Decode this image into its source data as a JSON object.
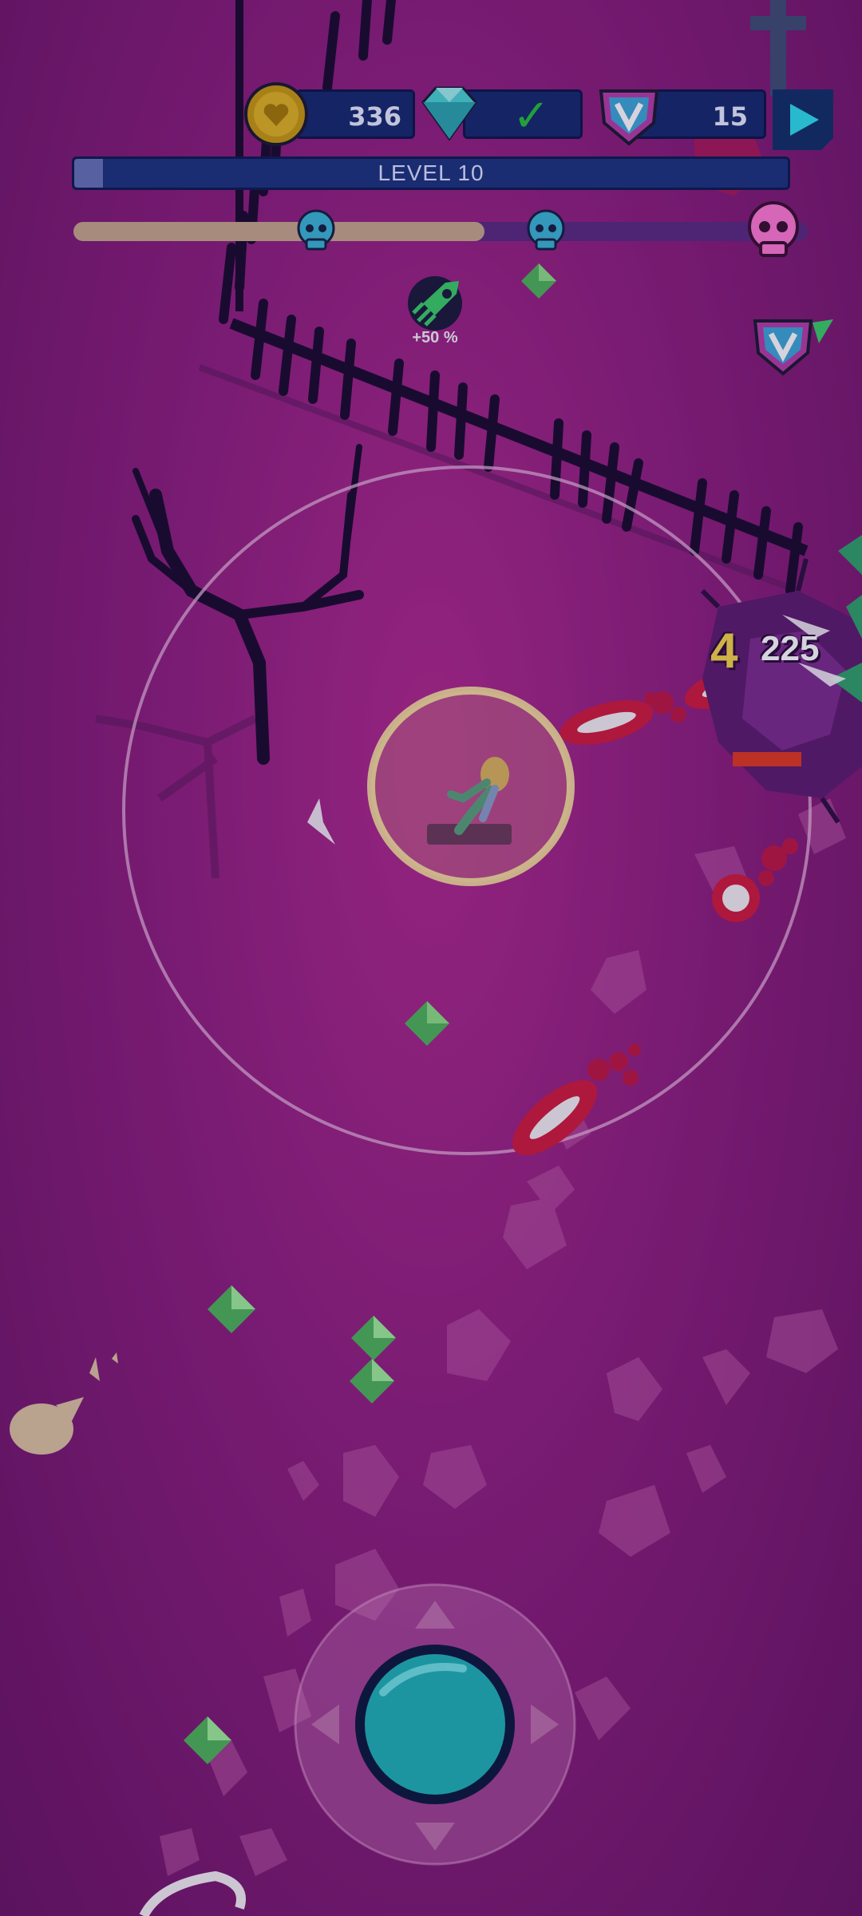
{
  "hud": {
    "coins": "336",
    "gems_check": "✓",
    "vtokens": "15",
    "level_label": "LEVEL 10",
    "level_progress": 0.04,
    "wave_progress": 0.56
  },
  "boost": {
    "label": "+50 %"
  },
  "combat": {
    "damage_main": "4",
    "damage_overlay": "225"
  },
  "colors": {
    "background": "#9a2386",
    "hud_blue": "#152a6e",
    "gem_green": "#5fd05f",
    "enemy_red": "#d01b3c",
    "joystick_teal": "#1fb4b8",
    "skull_blue": "#3ab7d6",
    "skull_pink": "#ff7ad3"
  },
  "icons": {
    "coin": "heart-coin-icon",
    "gem": "diamond-icon",
    "check": "checkmark-icon",
    "vtoken": "v-shield-icon",
    "play": "play-icon",
    "skull_mid": "skull-icon",
    "skull_boss": "boss-skull-icon",
    "boost": "speed-boost-icon"
  }
}
